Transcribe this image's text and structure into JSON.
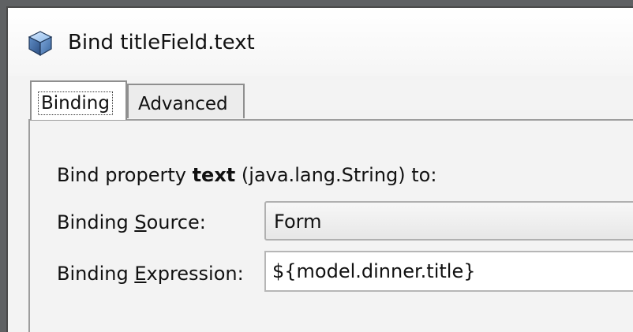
{
  "window": {
    "title": "Bind titleField.text",
    "icon": "cube-icon"
  },
  "tabs": [
    {
      "label": "Binding",
      "active": true
    },
    {
      "label": "Advanced",
      "active": false
    }
  ],
  "binding": {
    "intro_prefix": "Bind property ",
    "property_name": "text",
    "intro_suffix": " (java.lang.String) to:",
    "source_label_prefix": "Binding ",
    "source_label_mnemonic": "S",
    "source_label_suffix": "ource:",
    "source_value": "Form",
    "expression_label_prefix": "Binding ",
    "expression_label_mnemonic": "E",
    "expression_label_suffix": "xpression:",
    "expression_value": "${model.dinner.title}"
  },
  "colors": {
    "window_background": "#f3f3f3",
    "outer_background": "#5f6163",
    "border": "#9d9d9d",
    "text": "#111111",
    "input_background": "#ffffff"
  }
}
